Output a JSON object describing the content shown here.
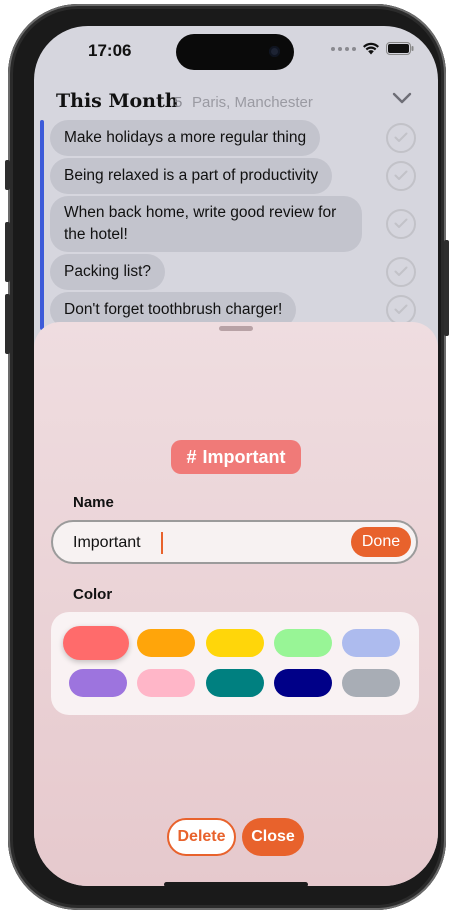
{
  "status_bar": {
    "time": "17:06"
  },
  "section": {
    "title": "This Month",
    "count": "5",
    "places": "Paris, Manchester"
  },
  "tasks": [
    {
      "text": "Make holidays a more regular thing"
    },
    {
      "text": "Being relaxed is a part of productivity"
    },
    {
      "text": "When back home, write good review for the hotel!"
    },
    {
      "text": "Packing list?"
    },
    {
      "text": "Don't forget toothbrush charger!"
    }
  ],
  "sheet": {
    "tag_symbol": "#",
    "tag_name": "Important",
    "name_label": "Name",
    "name_value": "Important",
    "done_label": "Done",
    "color_label": "Color",
    "selected_color": "#FF6B6B",
    "colors": [
      "#FF6B6B",
      "#FFA50A",
      "#FFD60A",
      "#98F596",
      "#ADBBEE",
      "#9D74DE",
      "#FFB6C8",
      "#008080",
      "#000088",
      "#A8ADB5"
    ],
    "delete_label": "Delete",
    "close_label": "Close"
  },
  "theme": {
    "accent": "#E8622C",
    "list_accent": "#3D5BD9"
  }
}
